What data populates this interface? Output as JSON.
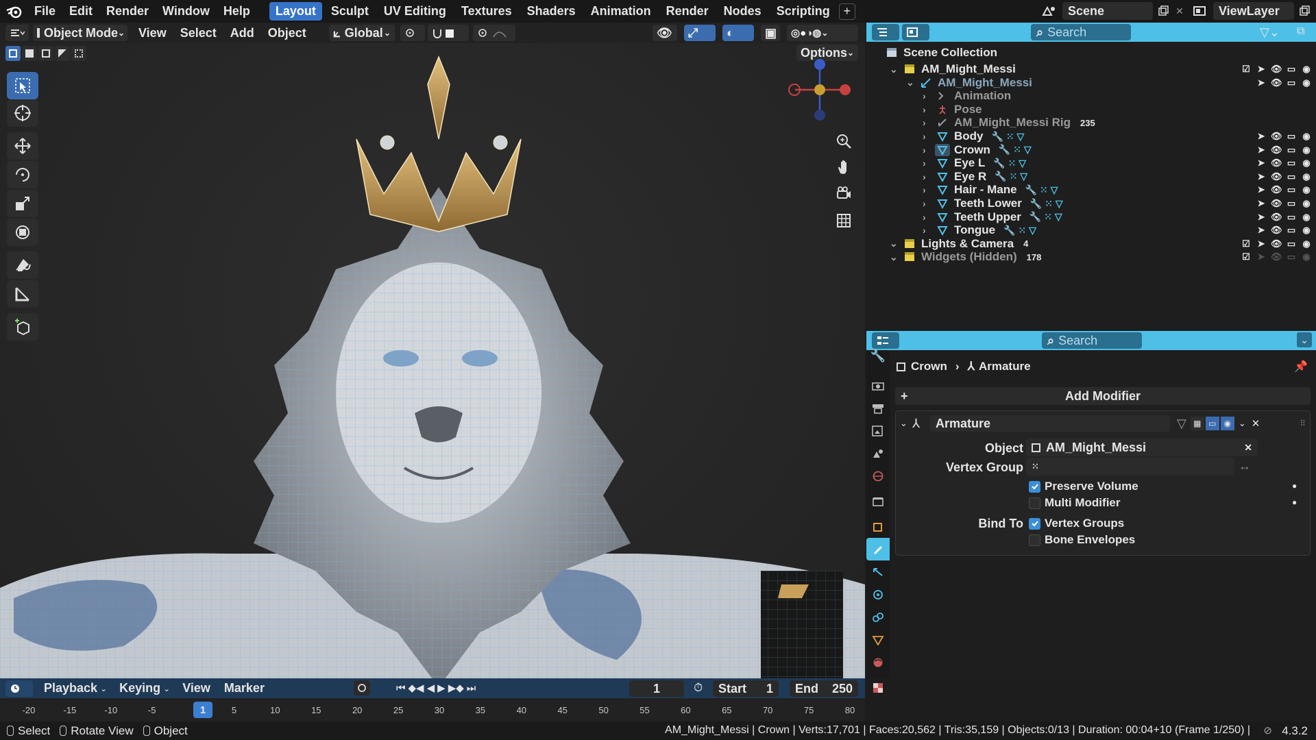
{
  "topbar": {
    "menus": [
      "File",
      "Edit",
      "Render",
      "Window",
      "Help"
    ],
    "workspaces": [
      "Layout",
      "Sculpt",
      "UV Editing",
      "Textures",
      "Shaders",
      "Animation",
      "Render",
      "Nodes",
      "Scripting"
    ],
    "active_workspace": "Layout",
    "add_workspace": "+",
    "scene": "Scene",
    "view_layer": "ViewLayer"
  },
  "viewport_header": {
    "mode": "Object Mode",
    "menus": [
      "View",
      "Select",
      "Add",
      "Object"
    ],
    "transform_orientation": "Global",
    "options": "Options"
  },
  "outliner": {
    "search_placeholder": "Search",
    "scene_collection": "Scene Collection",
    "rows": [
      {
        "name": "AM_Might_Messi",
        "indent": 1,
        "icon": "collection-icon"
      },
      {
        "name": "AM_Might_Messi",
        "indent": 2,
        "icon": "armature-icon"
      },
      {
        "name": "Animation",
        "indent": 3,
        "icon": "animation-icon"
      },
      {
        "name": "Pose",
        "indent": 3,
        "icon": "pose-icon"
      },
      {
        "name": "AM_Might_Messi Rig",
        "indent": 3,
        "icon": "armature-data-icon",
        "count": "235"
      },
      {
        "name": "Body",
        "indent": 3,
        "icon": "mesh-icon"
      },
      {
        "name": "Crown",
        "indent": 3,
        "icon": "mesh-icon",
        "selected": true
      },
      {
        "name": "Eye L",
        "indent": 3,
        "icon": "mesh-icon"
      },
      {
        "name": "Eye R",
        "indent": 3,
        "icon": "mesh-icon"
      },
      {
        "name": "Hair - Mane",
        "indent": 3,
        "icon": "mesh-icon"
      },
      {
        "name": "Teeth Lower",
        "indent": 3,
        "icon": "mesh-icon"
      },
      {
        "name": "Teeth Upper",
        "indent": 3,
        "icon": "mesh-icon"
      },
      {
        "name": "Tongue",
        "indent": 3,
        "icon": "mesh-icon"
      },
      {
        "name": "Lights & Camera",
        "indent": 1,
        "icon": "collection-icon",
        "count": "4"
      },
      {
        "name": "Widgets (Hidden)",
        "indent": 1,
        "icon": "collection-icon",
        "count": "178"
      }
    ]
  },
  "properties": {
    "search_placeholder": "Search",
    "breadcrumb_object": "Crown",
    "breadcrumb_modifier": "Armature",
    "add_modifier": "Add Modifier",
    "modifier_name": "Armature",
    "object_label": "Object",
    "object_value": "AM_Might_Messi",
    "vertex_group_label": "Vertex Group",
    "vertex_group_value": "",
    "preserve_volume": "Preserve Volume",
    "multi_modifier": "Multi Modifier",
    "bind_to_label": "Bind To",
    "vertex_groups": "Vertex Groups",
    "bone_envelopes": "Bone Envelopes"
  },
  "timeline": {
    "menus": [
      "Playback",
      "Keying",
      "View",
      "Marker"
    ],
    "current_frame": "1",
    "start_label": "Start",
    "start_value": "1",
    "end_label": "End",
    "end_value": "250",
    "ticks": [
      "-20",
      "-15",
      "-10",
      "-5",
      "1",
      "5",
      "10",
      "15",
      "20",
      "25",
      "30",
      "35",
      "40",
      "45",
      "50",
      "55",
      "60",
      "65",
      "70",
      "75",
      "80"
    ],
    "playhead": "1"
  },
  "statusbar": {
    "select": "Select",
    "rotate_view": "Rotate View",
    "object": "Object",
    "info": "AM_Might_Messi | Crown | Verts:17,701 | Faces:20,562 | Tris:35,159 | Objects:0/13 | Duration: 00:04+10 (Frame 1/250) |",
    "version": "4.3.2"
  },
  "colors": {
    "accent": "#4ec0e8",
    "active_tab": "#3574c8",
    "crown_gold": "#c9a05a",
    "mesh_cyan": "#3fc1e0"
  }
}
